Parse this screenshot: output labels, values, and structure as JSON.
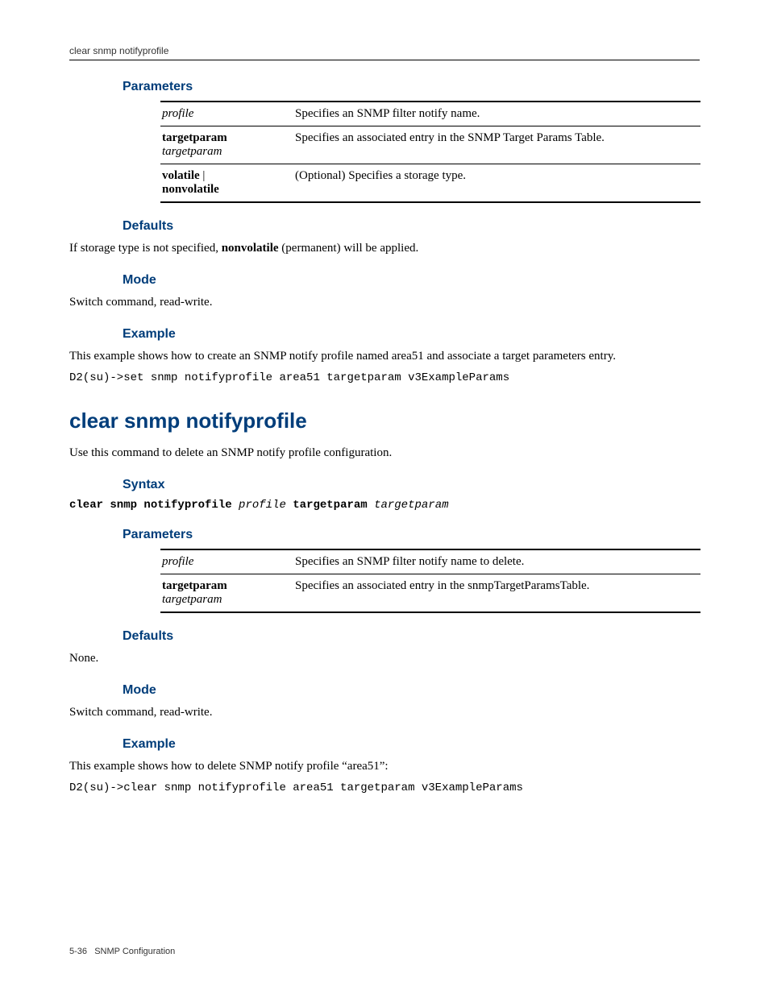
{
  "header": {
    "title": "clear snmp notifyprofile"
  },
  "sec1": {
    "parameters_heading": "Parameters",
    "table": {
      "r1": {
        "c1": "profile",
        "c2": "Specifies an SNMP filter notify name."
      },
      "r2": {
        "c1a": "targetparam",
        "c1b": "targetparam",
        "c2": "Specifies an associated entry in the SNMP Target Params Table."
      },
      "r3": {
        "c1a": "volatile",
        "c1sep": " | ",
        "c1b": "nonvolatile",
        "c2": "(Optional) Specifies a storage type."
      }
    },
    "defaults_heading": "Defaults",
    "defaults_text_a": "If storage type is not specified, ",
    "defaults_text_b": "nonvolatile",
    "defaults_text_c": " (permanent) will be applied.",
    "mode_heading": "Mode",
    "mode_text": "Switch command, read-write.",
    "example_heading": "Example",
    "example_text": "This example shows how to create an SNMP notify profile named area51 and associate a target parameters entry.",
    "example_code": "D2(su)->set snmp notifyprofile area51 targetparam v3ExampleParams"
  },
  "sec2": {
    "title": "clear snmp notifyprofile",
    "intro": "Use this command to delete an SNMP notify profile configuration.",
    "syntax_heading": "Syntax",
    "syntax": {
      "p1": "clear snmp notifyprofile ",
      "p2": "profile",
      "p3": " targetparam ",
      "p4": "targetparam"
    },
    "parameters_heading": "Parameters",
    "table": {
      "r1": {
        "c1": "profile",
        "c2": "Specifies an SNMP filter notify name to delete."
      },
      "r2": {
        "c1a": "targetparam",
        "c1b": "targetparam",
        "c2": "Specifies an associated entry in the snmpTargetParamsTable."
      }
    },
    "defaults_heading": "Defaults",
    "defaults_text": "None.",
    "mode_heading": "Mode",
    "mode_text": "Switch command, read-write.",
    "example_heading": "Example",
    "example_text": "This example shows how to delete SNMP notify profile “area51”:",
    "example_code": "D2(su)->clear snmp notifyprofile area51 targetparam v3ExampleParams"
  },
  "footer": {
    "page": "5-36",
    "label": "SNMP Configuration"
  }
}
